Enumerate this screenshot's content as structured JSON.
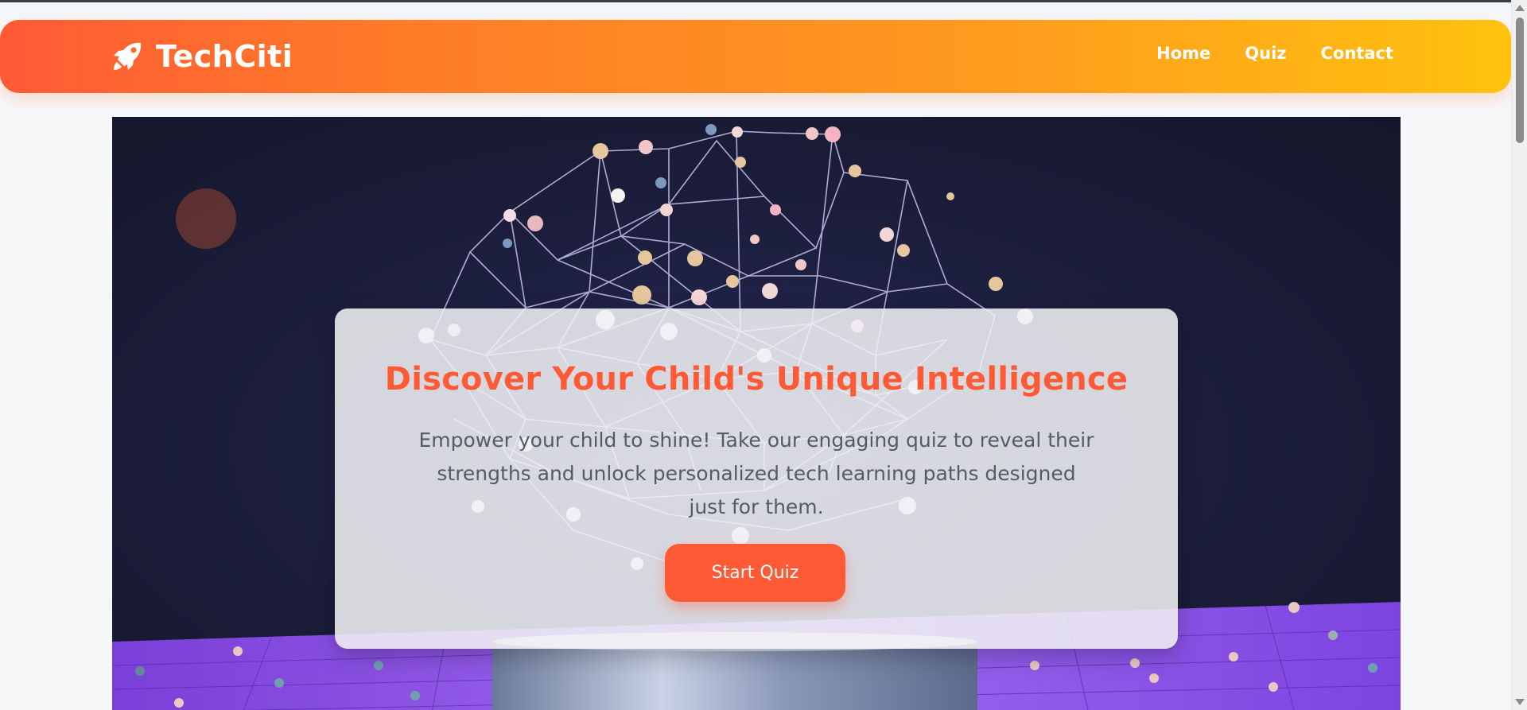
{
  "brand": {
    "name": "TechCiti",
    "icon": "rocket-icon"
  },
  "nav": {
    "links": [
      "Home",
      "Quiz",
      "Contact"
    ]
  },
  "hero": {
    "title": "Discover Your Child's Unique Intelligence",
    "description": "Empower your child to shine! Take our engaging quiz to reveal their strengths and unlock personalized tech learning paths designed just for them.",
    "cta_label": "Start Quiz"
  },
  "colors": {
    "accent": "#ff5a36",
    "nav_gradient_start": "#ff5a36",
    "nav_gradient_end": "#ffc20e",
    "hero_background": "#1d2040",
    "floor": "#8a48e8"
  }
}
